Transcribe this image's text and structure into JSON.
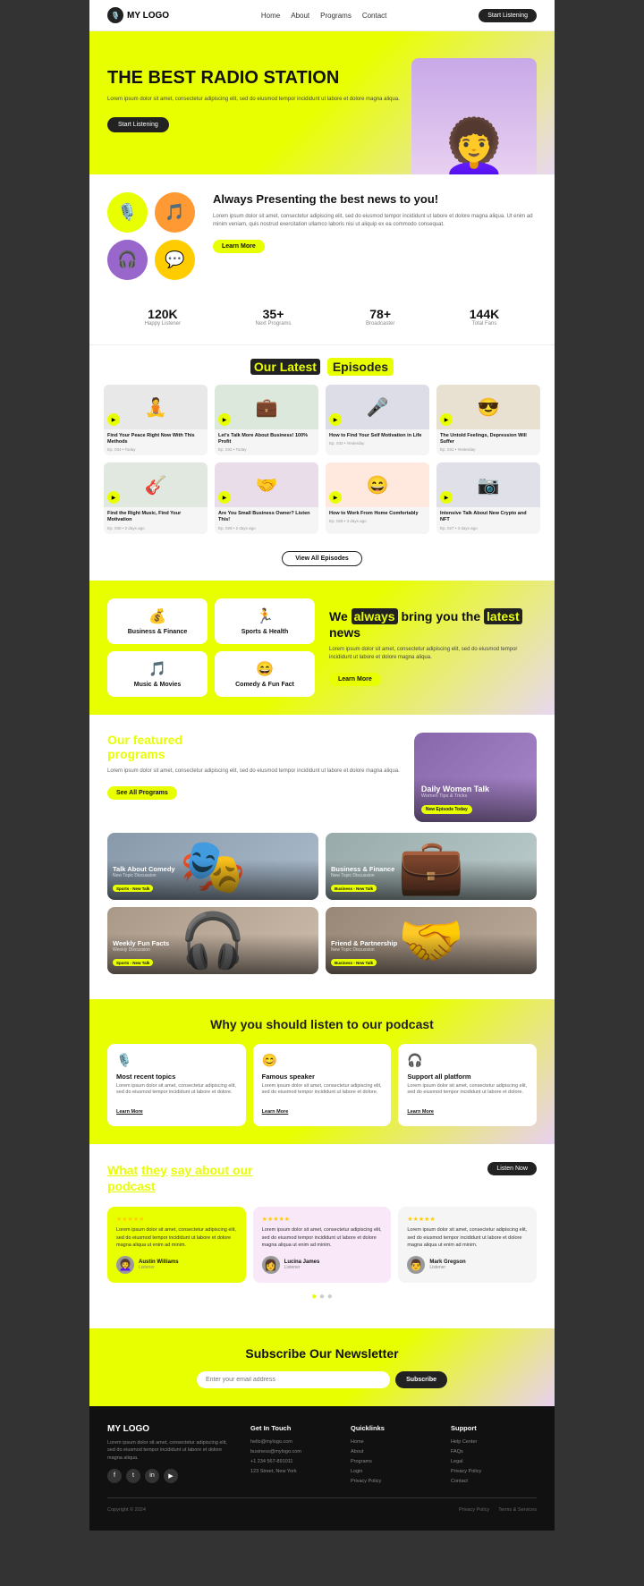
{
  "nav": {
    "logo_text": "MY LOGO",
    "links": [
      "Home",
      "About",
      "Programs",
      "Contact"
    ],
    "cta_label": "Start Listening"
  },
  "hero": {
    "title": "THE BEST RADIO STATION",
    "subtitle": "Lorem ipsum dolor sit amet, consectetur adipiscing elit, sed do eiusmod tempor incididunt ut labore et dolore magna aliqua.",
    "cta_label": "Start Listening",
    "person_emoji": "👩‍🦱"
  },
  "about": {
    "title": "Always Presenting the best news to you!",
    "description": "Lorem ipsum dolor sit amet, consectetur adipiscing elit, sed do eiusmod tempor incididunt ut labore et dolore magna aliqua. Ut enim ad minim veniam, quis nostrud exercitation ullamco laboris nisi ut aliquip ex ea commodo consequat.",
    "learn_more": "Learn More",
    "icons": [
      {
        "emoji": "🎙️",
        "color": "green"
      },
      {
        "emoji": "🎵",
        "color": "orange"
      },
      {
        "emoji": "🎧",
        "color": "purple"
      },
      {
        "emoji": "💬",
        "color": "yellow"
      }
    ]
  },
  "stats": [
    {
      "number": "120K",
      "label": "Happy Listener"
    },
    {
      "number": "35+",
      "label": "Next Programs"
    },
    {
      "number": "78+",
      "label": "Broadcaster"
    },
    {
      "number": "144K",
      "label": "Total Fans"
    }
  ],
  "episodes": {
    "section_title": "Our Latest",
    "section_highlight": "Episodes",
    "view_all": "View All Episodes",
    "items": [
      {
        "title": "Find Your Peace Right Now With This Methods",
        "meta": "Ep. 034 • Today",
        "emoji": "🧘"
      },
      {
        "title": "Let's Talk More About Business! 100% Profit",
        "meta": "Ep. 033 • Today",
        "emoji": "💼"
      },
      {
        "title": "How to Find Your Self Motivation in Life",
        "meta": "Ep. 032 • Yesterday",
        "emoji": "🎤"
      },
      {
        "title": "The Untold Feelings, Depression Will Suffer",
        "meta": "Ep. 031 • Yesterday",
        "emoji": "😎"
      },
      {
        "title": "Find the Right Music, Find Your Motivation",
        "meta": "Ep. 030 • 2 days ago",
        "emoji": "🎸"
      },
      {
        "title": "Are You Small Business Owner? Listen This!",
        "meta": "Ep. 029 • 2 days ago",
        "emoji": "🤝"
      },
      {
        "title": "How to Work From Home Comfortably",
        "meta": "Ep. 028 • 3 days ago",
        "emoji": "😄"
      },
      {
        "title": "Intensive Talk About New Crypto and NFT",
        "meta": "Ep. 027 • 3 days ago",
        "emoji": "📷"
      }
    ]
  },
  "categories": {
    "pre_text": "We",
    "highlight1": "always",
    "mid_text": "bring you the",
    "highlight2": "latest",
    "post_text": "news",
    "description": "Lorem ipsum dolor sit amet, consectetur adipiscing elit, sed do eiusmod tempor incididunt ut labore et dolore magna aliqua.",
    "learn_more": "Learn More",
    "items": [
      {
        "name": "Business & Finance",
        "icon": "💰"
      },
      {
        "name": "Sports & Health",
        "icon": "🏃"
      },
      {
        "name": "Music & Movies",
        "icon": "🎵"
      },
      {
        "name": "Comedy & Fun Fact",
        "icon": "😄"
      }
    ]
  },
  "featured": {
    "pre_title": "Our featured",
    "title_highlight": "programs",
    "description": "Lorem ipsum dolor sit amet, consectetur adipiscing elit, sed do eiusmod tempor incididunt ut labore et dolore magna aliqua.",
    "see_programs": "See All Programs",
    "main_program": {
      "title": "Daily Women Talk",
      "subtitle": "Women Tips & Tricks",
      "badge": "New Episode Today"
    },
    "programs": [
      {
        "title": "Talk About Comedy",
        "subtitle": "New Topic Discussion",
        "badge": "Sports - New Talk",
        "bg": "comedy"
      },
      {
        "title": "Business & Finance",
        "subtitle": "New Topic Discussion",
        "badge": "Business - New Talk",
        "bg": "business"
      },
      {
        "title": "Weekly Fun Facts",
        "subtitle": "Weekly Discussion",
        "badge": "Sports - New Talk",
        "bg": "weekly"
      },
      {
        "title": "Friend & Partnership",
        "subtitle": "New Topic Discussion",
        "badge": "Business - New Talk",
        "bg": "friend"
      }
    ]
  },
  "why": {
    "pre": "Why you should",
    "highlight": "listen",
    "post": "to our podcast",
    "cards": [
      {
        "icon": "🎙️",
        "title": "Most recent topics",
        "description": "Lorem ipsum dolor sit amet, consectetur adipiscing elit, sed do eiusmod tempor incididunt ut labore et dolore.",
        "link": "Learn More"
      },
      {
        "icon": "😊",
        "title": "Famous speaker",
        "description": "Lorem ipsum dolor sit amet, consectetur adipiscing elit, sed do eiusmod tempor incididunt ut labore et dolore.",
        "link": "Learn More"
      },
      {
        "icon": "🎧",
        "title": "Support all platform",
        "description": "Lorem ipsum dolor sit amet, consectetur adipiscing elit, sed do eiusmod tempor incididunt ut labore et dolore.",
        "link": "Learn More"
      }
    ]
  },
  "testimonials": {
    "pre": "What",
    "highlight": "they",
    "post": "say about our",
    "highlight2": "podcast",
    "listen_now": "Listen Now",
    "items": [
      {
        "rating": "★★★★★",
        "text": "Lorem ipsum dolor sit amet, consectetur adipiscing elit, sed do eiusmod tempor incididunt ut labore et dolore magna aliqua ut enim ad minim.",
        "name": "Austin Williams",
        "role": "Listener",
        "bg": "yellow-bg",
        "avatar": "👩‍🦱"
      },
      {
        "rating": "★★★★★",
        "text": "Lorem ipsum dolor sit amet, consectetur adipiscing elit, sed do eiusmod tempor incididunt ut labore et dolore magna aliqua ut enim ad minim.",
        "name": "Lucina James",
        "role": "Listener",
        "bg": "pink-bg",
        "avatar": "👩"
      },
      {
        "rating": "★★★★★",
        "text": "Lorem ipsum dolor sit amet, consectetur adipiscing elit, sed do eiusmod tempor incididunt ut labore et dolore magna aliqua ut enim ad minim.",
        "name": "Mark Gregson",
        "role": "Listener",
        "bg": "white-bg",
        "avatar": "👨"
      }
    ]
  },
  "newsletter": {
    "title": "Subscribe Our Newsletter",
    "placeholder": "Enter your email address",
    "submit": "Subscribe"
  },
  "footer": {
    "brand": {
      "name": "MY LOGO",
      "description": "Lorem ipsum dolor sit amet, consectetur adipiscing elit, sed do eiusmod tempor incididunt ut labore et dolore magna aliqua.",
      "socials": [
        "f",
        "t",
        "in",
        "yt"
      ]
    },
    "contact": {
      "title": "Get In Touch",
      "items": [
        "hello@mylogo.com",
        "business@mylogo.com",
        "+1 234 567-891011",
        "123 Street, New York"
      ]
    },
    "quicklinks": {
      "title": "Quicklinks",
      "items": [
        "Home",
        "About",
        "Programs",
        "Login",
        "Privacy Policy"
      ]
    },
    "support": {
      "title": "Support",
      "items": [
        "Help Center",
        "FAQs",
        "Legal",
        "Privacy Policy",
        "Contact"
      ]
    },
    "copyright": "Copyright © 2024",
    "bottom_links": [
      "Privacy Policy",
      "Terms & Services"
    ]
  }
}
